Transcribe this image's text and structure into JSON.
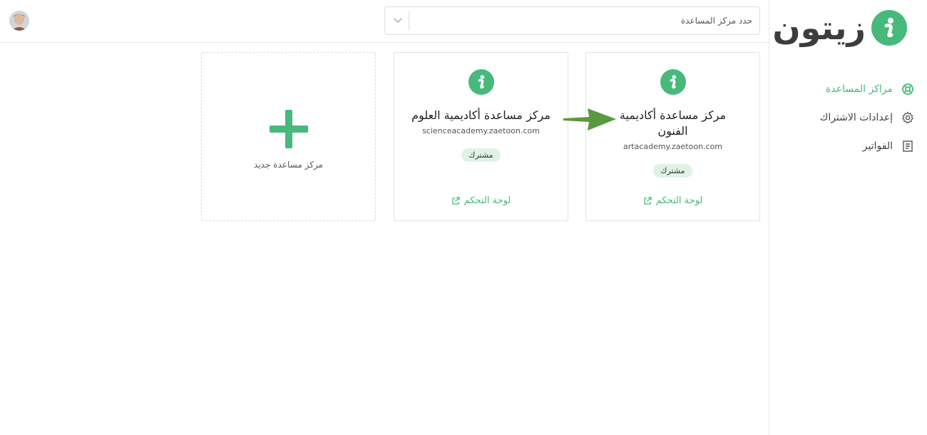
{
  "brand": {
    "name": "زيتون",
    "accent": "#47b97a"
  },
  "sidebar": {
    "items": [
      {
        "label": "مراكز المساعدة",
        "icon": "lifebuoy-icon",
        "active": true
      },
      {
        "label": "إعدادات الاشتراك",
        "icon": "gear-icon",
        "active": false
      },
      {
        "label": "الفواتير",
        "icon": "receipt-icon",
        "active": false
      }
    ]
  },
  "header": {
    "select_placeholder": "حدد مركز المساعدة"
  },
  "cards": [
    {
      "title": "مركز مساعدة أكاديمية الفنون",
      "domain": "artacademy.zaetoon.com",
      "badge": "مشترك",
      "link": "لوحة التحكم"
    },
    {
      "title": "مركز مساعدة أكاديمية العلوم",
      "domain": "scienceacademy.zaetoon.com",
      "badge": "مشترك",
      "link": "لوحة التحكم"
    }
  ],
  "new_card": {
    "label": "مركز مساعدة جديد"
  }
}
